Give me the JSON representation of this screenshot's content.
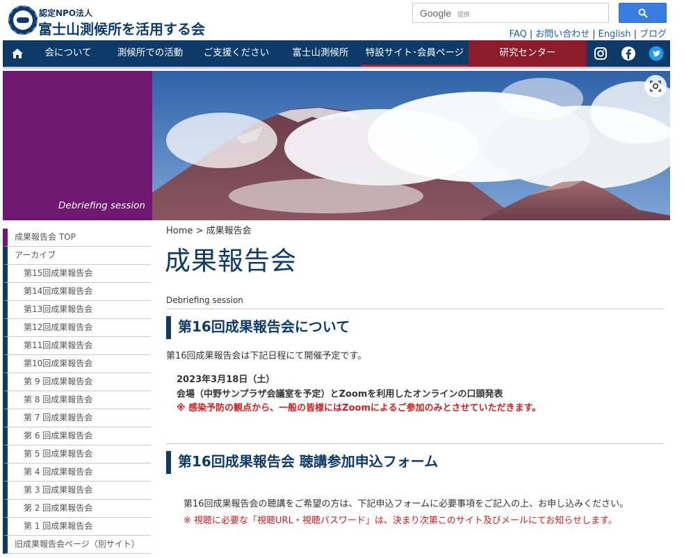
{
  "header": {
    "org_type": "認定NPO法人",
    "org_name": "富士山測候所を活用する会",
    "search": {
      "brand": "Google",
      "sub": "提供"
    },
    "util_links": [
      "FAQ",
      "お問い合わせ",
      "English",
      "ブログ"
    ]
  },
  "nav": {
    "items": [
      "会について",
      "測候所での活動",
      "ご支援ください",
      "富士山測候所",
      "特設サイト･会員ページ",
      "研究センター"
    ]
  },
  "hero": {
    "caption": "Debriefing session"
  },
  "sidebar": {
    "items": [
      "成果報告会 TOP",
      "アーカイブ",
      "第15回成果報告会",
      "第14回成果報告会",
      "第13回成果報告会",
      "第12回成果報告会",
      "第11回成果報告会",
      "第10回成果報告会",
      "第 9 回成果報告会",
      "第 8 回成果報告会",
      "第 7 回成果報告会",
      "第 6 回成果報告会",
      "第 5 回成果報告会",
      "第 4 回成果報告会",
      "第 3 回成果報告会",
      "第 2 回成果報告会",
      "第 1 回成果報告会",
      "旧成果報告会ページ（別サイト）"
    ]
  },
  "main": {
    "breadcrumb": {
      "home": "Home",
      "sep": ">",
      "current": "成果報告会"
    },
    "title": "成果報告会",
    "section_label": "Debriefing session",
    "section1": {
      "heading": "第16回成果報告会について",
      "intro": "第16回成果報告会は下記日程にて開催予定です。",
      "date": "2023年3月18日（土）",
      "venue": "会場（中野サンプラザ会議室を予定）とZoomを利用したオンラインの口頭発表",
      "notice": "※ 感染予防の観点から、一般の皆様にはZoomによるご参加のみとさせていただきます。"
    },
    "section2": {
      "heading": "第16回成果報告会 聴講参加申込フォーム",
      "text": "第16回成果報告会の聴講をご希望の方は、下記申込フォームに必要事項をご記入の上、お申し込みください。",
      "notice": "※ 視聴に必要な「視聴URL・視聴パスワード」は、決まり次第このサイト及びメールにてお知らせします。"
    }
  },
  "colors": {
    "navy": "#0e3a6a",
    "purple": "#6e1872",
    "crimson": "#8e1b2b",
    "red": "#d61a1a",
    "link": "#1a5ea8"
  }
}
